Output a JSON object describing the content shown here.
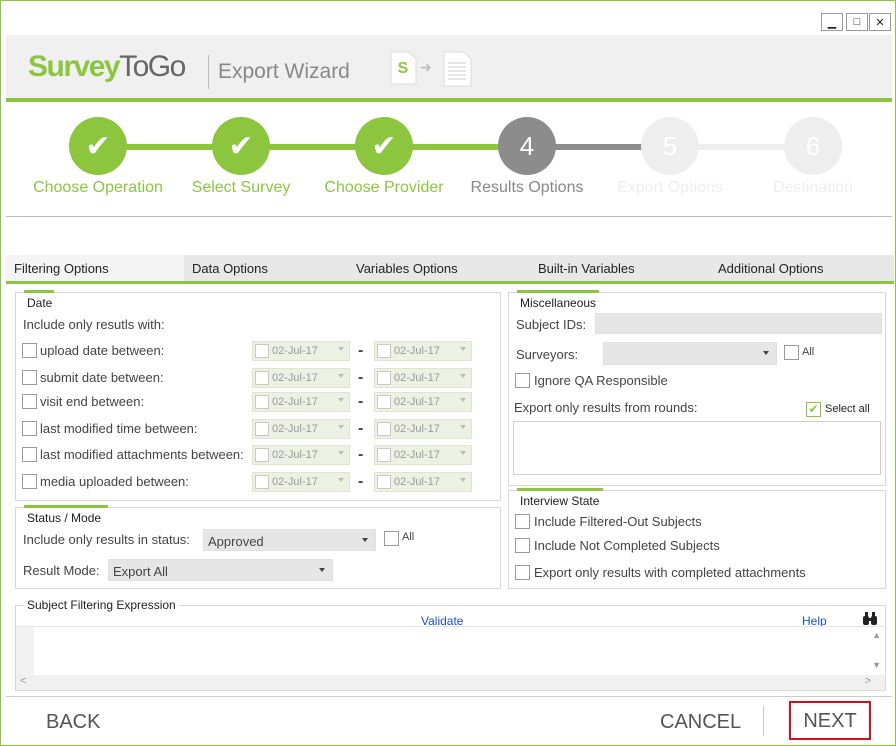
{
  "window": {
    "minimize": "▁",
    "maximize": "□",
    "close": "✕"
  },
  "header": {
    "logo_a": "Survey",
    "logo_b": "ToGo",
    "title": "Export Wizard",
    "icon_letter": "S",
    "icon_arrow": "➜"
  },
  "stepper": {
    "steps": [
      {
        "label": "Choose Operation",
        "mark": "✔",
        "state": "done"
      },
      {
        "label": "Select Survey",
        "mark": "✔",
        "state": "done"
      },
      {
        "label": "Choose Provider",
        "mark": "✔",
        "state": "done"
      },
      {
        "label": "Results Options",
        "mark": "4",
        "state": "current"
      },
      {
        "label": "Export Options",
        "mark": "5",
        "state": "pending"
      },
      {
        "label": "Destination",
        "mark": "6",
        "state": "pending"
      }
    ],
    "colors": {
      "done": "#8cc63f",
      "current": "#8c8c8c",
      "pending": "#eeeeee"
    }
  },
  "tabs": [
    {
      "label": "Filtering Options",
      "active": true
    },
    {
      "label": "Data Options",
      "active": false
    },
    {
      "label": "Variables Options",
      "active": false
    },
    {
      "label": "Built-in Variables",
      "active": false
    },
    {
      "label": "Additional Options",
      "active": false
    }
  ],
  "date": {
    "legend": "Date",
    "intro": "Include only resutls with:",
    "separator": "-",
    "rows": [
      {
        "label": "upload date between:",
        "from": "02-Jul-17",
        "to": "02-Jul-17"
      },
      {
        "label": "submit date between:",
        "from": "02-Jul-17",
        "to": "02-Jul-17"
      },
      {
        "label": "visit end between:",
        "from": "02-Jul-17",
        "to": "02-Jul-17"
      },
      {
        "label": "last modified time between:",
        "from": "02-Jul-17",
        "to": "02-Jul-17"
      },
      {
        "label": "last modified attachments between:",
        "from": "02-Jul-17",
        "to": "02-Jul-17"
      },
      {
        "label": "media uploaded between:",
        "from": "02-Jul-17",
        "to": "02-Jul-17"
      }
    ]
  },
  "status": {
    "legend": "Status / Mode",
    "status_label": "Include only results in status:",
    "status_value": "Approved",
    "all_label": "All",
    "mode_label": "Result Mode:",
    "mode_value": "Export All"
  },
  "misc": {
    "legend": "Miscellaneous",
    "subject_ids_label": "Subject IDs:",
    "subject_ids_value": "",
    "surveyors_label": "Surveyors:",
    "surveyors_value": "",
    "all_label": "All",
    "ignore_qa": "Ignore QA Responsible",
    "rounds_label": "Export only results from rounds:",
    "select_all": "Select all",
    "select_all_mark": "✔"
  },
  "interview": {
    "legend": "Interview State",
    "options": [
      "Include Filtered-Out Subjects",
      "Include Not Completed Subjects",
      "Export only results with completed attachments"
    ]
  },
  "expression": {
    "legend": "Subject Filtering Expression",
    "validate": "Validate",
    "help": "Help",
    "find_icon": "binoculars-icon",
    "value": ""
  },
  "footer": {
    "back": "BACK",
    "cancel": "CANCEL",
    "next": "NEXT",
    "next_border": "#d4101c"
  }
}
